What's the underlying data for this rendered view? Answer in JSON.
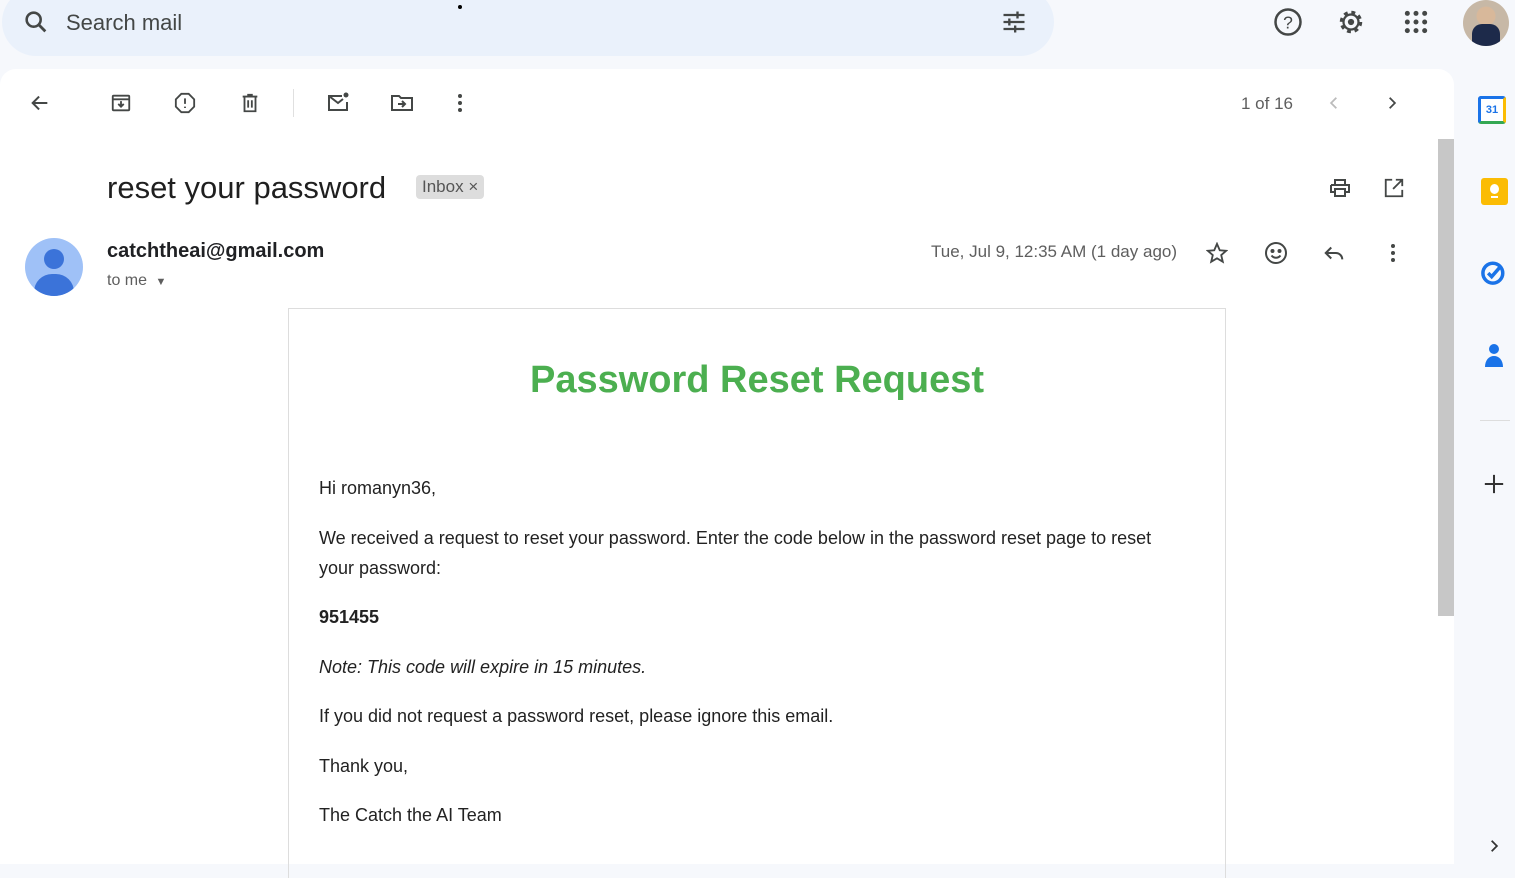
{
  "search": {
    "placeholder": "Search mail"
  },
  "toolbar": {
    "pagination": "1 of 16"
  },
  "email": {
    "subject": "reset your password",
    "label": "Inbox",
    "label_remove": "×",
    "sender": "catchtheai@gmail.com",
    "recipient": "to me",
    "date": "Tue, Jul 9, 12:35 AM (1 day ago)",
    "body": {
      "heading": "Password Reset Request",
      "greeting": "Hi romanyn36,",
      "intro": "We received a request to reset your password. Enter the code below in the password reset page to reset your password:",
      "code": "951455",
      "note": "Note: This code will expire in 15 minutes.",
      "ignore": "If you did not request a password reset, please ignore this email.",
      "thanks": "Thank you,",
      "signature": "The Catch the AI Team"
    }
  },
  "side_panel": {
    "calendar_day": "31"
  },
  "colors": {
    "heading_green": "#4caf50",
    "calendar_blue": "#1a73e8",
    "keep_yellow": "#fbbc04"
  }
}
